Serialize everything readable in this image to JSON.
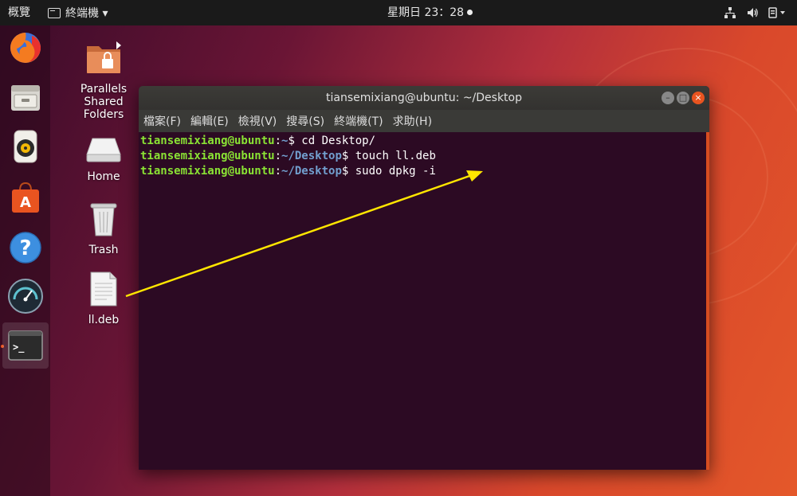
{
  "topbar": {
    "activities": "概覽",
    "app_menu": "終端機 ▾",
    "clock": "星期日 23：28"
  },
  "desktop_icons": [
    {
      "label": "Parallels\nShared\nFolders"
    },
    {
      "label": "Home"
    },
    {
      "label": "Trash"
    },
    {
      "label": "ll.deb"
    }
  ],
  "terminal": {
    "title": "tiansemixiang@ubuntu: ~/Desktop",
    "menu": [
      "檔案(F)",
      "編輯(E)",
      "檢視(V)",
      "搜尋(S)",
      "終端機(T)",
      "求助(H)"
    ],
    "lines": [
      {
        "user": "tiansemixiang@ubuntu",
        "path": "~",
        "cmd": "$ cd Desktop/"
      },
      {
        "user": "tiansemixiang@ubuntu",
        "path": "~/Desktop",
        "cmd": "$ touch ll.deb"
      },
      {
        "user": "tiansemixiang@ubuntu",
        "path": "~/Desktop",
        "cmd": "$ sudo dpkg -i"
      }
    ]
  },
  "colors": {
    "accent": "#e95420",
    "terminal_bg": "#2c0a23",
    "user_green": "#8ae234",
    "path_blue": "#729fcf",
    "arrow": "#ffe600"
  }
}
